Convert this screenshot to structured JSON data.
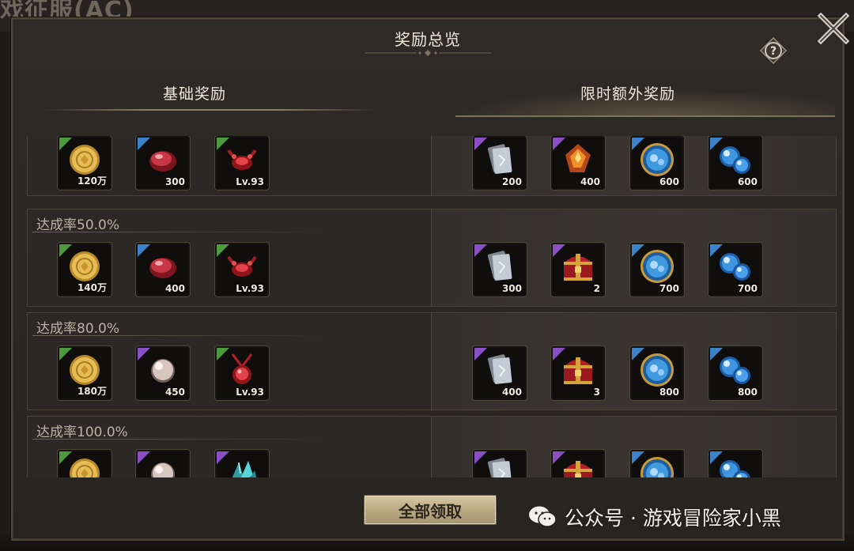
{
  "background": {
    "title": "戏征服(AC)"
  },
  "dialog": {
    "title": "奖励总览",
    "help_label": "?",
    "basic_header": "基础奖励",
    "extra_header": "限时额外奖励",
    "claim_all_label": "全部领取"
  },
  "tiers": [
    {
      "label": "",
      "basic": [
        {
          "icon": "gold-coin-icon",
          "qty": "120万",
          "rarity": "green"
        },
        {
          "icon": "red-gem-icon",
          "qty": "300",
          "rarity": "blue"
        },
        {
          "icon": "red-necklace-icon",
          "qty": "Lv.93",
          "rarity": "green"
        }
      ],
      "extra": [
        {
          "icon": "card-icon",
          "qty": "200",
          "rarity": "purple"
        },
        {
          "icon": "orange-crystal-icon",
          "qty": "400",
          "rarity": "purple"
        },
        {
          "icon": "blue-medal-icon",
          "qty": "600",
          "rarity": "blue"
        },
        {
          "icon": "blue-orbs-icon",
          "qty": "600",
          "rarity": "blue"
        }
      ]
    },
    {
      "label": "达成率50.0%",
      "basic": [
        {
          "icon": "gold-coin-icon",
          "qty": "140万",
          "rarity": "green"
        },
        {
          "icon": "red-gem-icon",
          "qty": "400",
          "rarity": "blue"
        },
        {
          "icon": "red-necklace-icon",
          "qty": "Lv.93",
          "rarity": "green"
        }
      ],
      "extra": [
        {
          "icon": "card-icon",
          "qty": "300",
          "rarity": "purple"
        },
        {
          "icon": "treasure-chest-icon",
          "qty": "2",
          "rarity": "purple"
        },
        {
          "icon": "blue-medal-icon",
          "qty": "700",
          "rarity": "blue"
        },
        {
          "icon": "blue-orbs-icon",
          "qty": "700",
          "rarity": "blue"
        }
      ]
    },
    {
      "label": "达成率80.0%",
      "basic": [
        {
          "icon": "gold-coin-icon",
          "qty": "180万",
          "rarity": "green"
        },
        {
          "icon": "pearl-icon",
          "qty": "450",
          "rarity": "purple"
        },
        {
          "icon": "red-pendant-icon",
          "qty": "Lv.93",
          "rarity": "green"
        }
      ],
      "extra": [
        {
          "icon": "card-icon",
          "qty": "400",
          "rarity": "purple"
        },
        {
          "icon": "treasure-chest-icon",
          "qty": "3",
          "rarity": "purple"
        },
        {
          "icon": "blue-medal-icon",
          "qty": "800",
          "rarity": "blue"
        },
        {
          "icon": "blue-orbs-icon",
          "qty": "800",
          "rarity": "blue"
        }
      ]
    },
    {
      "label": "达成率100.0%",
      "basic": [
        {
          "icon": "gold-coin-icon",
          "qty": "",
          "rarity": "green"
        },
        {
          "icon": "pearl-icon",
          "qty": "",
          "rarity": "purple"
        },
        {
          "icon": "teal-crystal-icon",
          "qty": "",
          "rarity": "purple"
        }
      ],
      "extra": [
        {
          "icon": "card-icon",
          "qty": "",
          "rarity": "purple"
        },
        {
          "icon": "treasure-chest-icon",
          "qty": "",
          "rarity": "purple"
        },
        {
          "icon": "blue-medal-icon",
          "qty": "",
          "rarity": "blue"
        },
        {
          "icon": "blue-orbs-icon",
          "qty": "",
          "rarity": "blue"
        }
      ]
    }
  ],
  "watermark": {
    "text": "公众号 · 游戏冒险家小黑"
  },
  "colors": {
    "rarity_green": "#4e9b3f",
    "rarity_purple": "#8a4fc5",
    "rarity_blue": "#3b82c9",
    "accent_gold": "#b9a983"
  }
}
